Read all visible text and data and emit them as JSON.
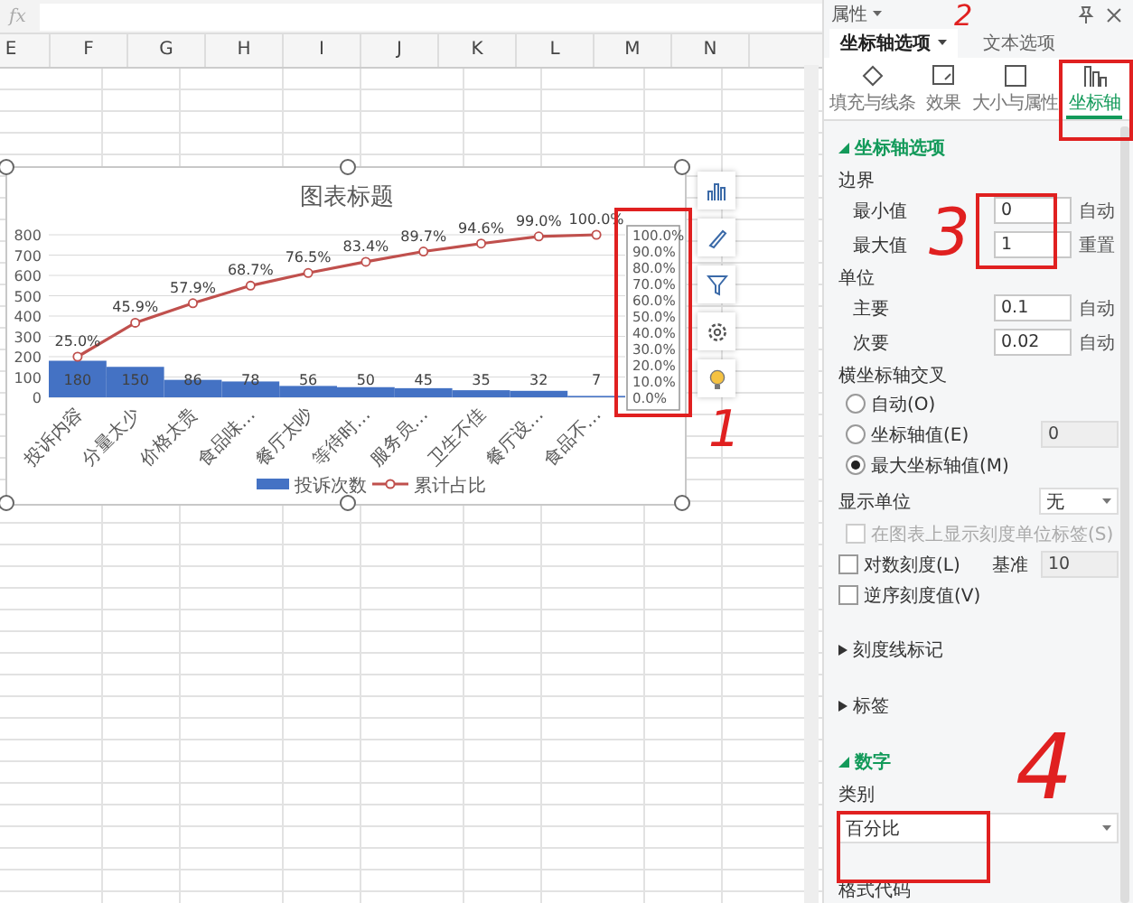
{
  "formula_bar": {
    "label": "fx"
  },
  "columns": [
    "E",
    "F",
    "G",
    "H",
    "I",
    "J",
    "K",
    "L",
    "M",
    "N"
  ],
  "chart": {
    "chart_data": {
      "type": "bar",
      "title": "图表标题",
      "categories": [
        "投诉内容",
        "分量太少",
        "价格太贵",
        "食品味…",
        "餐厅太吵",
        "等待时…",
        "服务员…",
        "卫生不佳",
        "餐厅设…",
        "食品不…"
      ],
      "series": [
        {
          "name": "投诉次数",
          "color": "#4472c4",
          "type": "bar",
          "values": [
            180,
            150,
            86,
            78,
            56,
            50,
            45,
            35,
            32,
            7
          ],
          "value_labels": [
            "180",
            "150",
            "86",
            "78",
            "56",
            "50",
            "45",
            "35",
            "32",
            "7"
          ]
        },
        {
          "name": "累计占比",
          "color": "#c0504d",
          "type": "line",
          "axis": "y2",
          "marker": true,
          "values": [
            25.0,
            45.9,
            57.9,
            68.7,
            76.5,
            83.4,
            89.7,
            94.6,
            99.0,
            100.0
          ],
          "value_labels": [
            "25.0%",
            "45.9%",
            "57.9%",
            "68.7%",
            "76.5%",
            "83.4%",
            "89.7%",
            "94.6%",
            "99.0%",
            "100.0%"
          ]
        }
      ],
      "ylim": [
        0,
        800
      ],
      "yticks": [
        0,
        100,
        200,
        300,
        400,
        500,
        600,
        700,
        800
      ],
      "y2lim": [
        0,
        100
      ],
      "y2ticks": [
        {
          "value": 0,
          "label": "0.0%"
        },
        {
          "value": 10,
          "label": "10.0%"
        },
        {
          "value": 20,
          "label": "20.0%"
        },
        {
          "value": 30,
          "label": "30.0%"
        },
        {
          "value": 40,
          "label": "40.0%"
        },
        {
          "value": 50,
          "label": "50.0%"
        },
        {
          "value": 60,
          "label": "60.0%"
        },
        {
          "value": 70,
          "label": "70.0%"
        },
        {
          "value": 80,
          "label": "80.0%"
        },
        {
          "value": 90,
          "label": "90.0%"
        },
        {
          "value": 100,
          "label": "100.0%"
        }
      ],
      "grid": true,
      "legend": true,
      "data_labels": true
    }
  },
  "panel": {
    "title": "属性",
    "tabs": [
      {
        "label": "坐标轴选项",
        "selected": true
      },
      {
        "label": "文本选项",
        "selected": false
      }
    ],
    "icon_tabs": [
      {
        "label": "填充与线条",
        "selected": false
      },
      {
        "label": "效果",
        "selected": false
      },
      {
        "label": "大小与属性",
        "selected": false
      },
      {
        "label": "坐标轴",
        "selected": true
      }
    ],
    "axis_section": {
      "title": "坐标轴选项",
      "expanded": true,
      "bounds_label": "边界",
      "bounds": [
        {
          "label": "最小值",
          "value": "0",
          "action": "自动"
        },
        {
          "label": "最大值",
          "value": "1",
          "action": "重置"
        }
      ],
      "units_label": "单位",
      "units": [
        {
          "label": "主要",
          "value": "0.1",
          "action": "自动"
        },
        {
          "label": "次要",
          "value": "0.02",
          "action": "自动"
        }
      ],
      "cross_label": "横坐标轴交叉",
      "cross_options": [
        {
          "label": "自动(O)",
          "selected": false
        },
        {
          "label": "坐标轴值(E)",
          "selected": false,
          "value": "0"
        },
        {
          "label": "最大坐标轴值(M)",
          "selected": true
        }
      ],
      "display_unit_label": "显示单位",
      "display_unit": "无",
      "show_unit_label": {
        "label": "在图表上显示刻度单位标签(S)",
        "checked": false,
        "disabled": true
      },
      "log_scale": {
        "label": "对数刻度(L)",
        "checked": false,
        "base_label": "基准",
        "base": "10"
      },
      "reverse": {
        "label": "逆序刻度值(V)",
        "checked": false
      }
    },
    "collapsed_sections": [
      {
        "title": "刻度线标记",
        "expanded": false
      },
      {
        "title": "标签",
        "expanded": false
      }
    ],
    "number_section": {
      "title": "数字",
      "expanded": true,
      "category_label": "类别",
      "category": "百分比",
      "format_label": "格式代码"
    }
  },
  "annotations": [
    {
      "label": "1"
    },
    {
      "label": "2"
    },
    {
      "label": "3"
    },
    {
      "label": "4"
    }
  ]
}
